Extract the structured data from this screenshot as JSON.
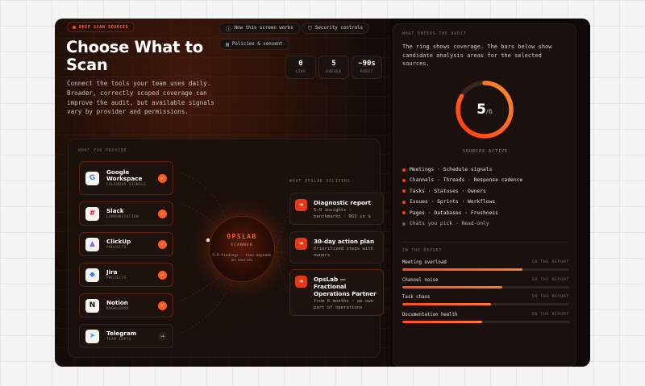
{
  "header": {
    "badge": "DEEP SCAN SOURCES",
    "title": "Choose What to Scan",
    "description": "Connect the tools your team uses daily. Broader, correctly scoped coverage can improve the audit, but available signals vary by provider and permissions.",
    "links": [
      {
        "label": "How this screen works",
        "icon": "info-icon"
      },
      {
        "label": "Security controls",
        "icon": "shield-icon"
      },
      {
        "label": "Policies & consent",
        "icon": "document-icon"
      }
    ],
    "stats": [
      {
        "value": "0",
        "label": "LIVE"
      },
      {
        "value": "5",
        "label": "QUEUED"
      },
      {
        "value": "~90s",
        "label": "AUDIT"
      }
    ]
  },
  "provide": {
    "label": "WHAT YOU PROVIDE",
    "sources": [
      {
        "name": "Google Workspace",
        "sub": "CALENDAR SIGNALS",
        "logo": "G",
        "logo_color": "#4285f4",
        "selected": true
      },
      {
        "name": "Slack",
        "sub": "COMMUNICATION",
        "logo": "#",
        "logo_color": "#e01e5a",
        "selected": true
      },
      {
        "name": "ClickUp",
        "sub": "PROJECTS",
        "logo": "▲",
        "logo_color": "#7b68ee",
        "selected": true
      },
      {
        "name": "Jira",
        "sub": "PROJECTS",
        "logo": "◆",
        "logo_color": "#2684ff",
        "selected": true
      },
      {
        "name": "Notion",
        "sub": "KNOWLEDGE",
        "logo": "N",
        "logo_color": "#111111",
        "selected": true
      },
      {
        "name": "Telegram",
        "sub": "TEAM CHATS",
        "logo": "➤",
        "logo_color": "#2aabee",
        "selected": false
      }
    ]
  },
  "scanner": {
    "title": "OPSLAB",
    "subtitle": "SCANNER",
    "note": "5–9 findings · time depends on sources"
  },
  "delivers": {
    "label": "WHAT OPSLAB DELIVERS",
    "items": [
      {
        "title": "Diagnostic report",
        "sub": "5–9 insights · benchmarks · ROI in $"
      },
      {
        "title": "30-day action plan",
        "sub": "Prioritized steps with owners"
      },
      {
        "title": "OpsLab — Fractional Operations Partner",
        "sub": "from 6 months · we own part of operations"
      }
    ]
  },
  "audit": {
    "label": "WHAT ENTERS THE AUDIT",
    "text": "The ring shows coverage. The bars below show candidate analysis areas for the selected sources.",
    "ring": {
      "count": "5",
      "total": "/6",
      "fraction": 0.8333,
      "label": "SOURCES ACTIVE"
    },
    "signals": [
      {
        "text": "Meetings · Schedule signals",
        "active": true
      },
      {
        "text": "Channels · Threads · Response cadence",
        "active": true
      },
      {
        "text": "Tasks · Statuses · Owners",
        "active": true
      },
      {
        "text": "Issues · Sprints · Workflows",
        "active": true
      },
      {
        "text": "Pages · Databases · Freshness",
        "active": true
      },
      {
        "text": "Chats you pick · Read-only",
        "active": false
      }
    ],
    "report_label": "IN THE REPORT",
    "report": [
      {
        "name": "Meeting overload",
        "tag": "IN THE REPORT",
        "level": 0.72
      },
      {
        "name": "Channel noise",
        "tag": "IN THE REPORT",
        "level": 0.6
      },
      {
        "name": "Task chaos",
        "tag": "IN THE REPORT",
        "level": 0.53
      },
      {
        "name": "Documentation health",
        "tag": "IN THE REPORT",
        "level": 0.48
      }
    ]
  }
}
